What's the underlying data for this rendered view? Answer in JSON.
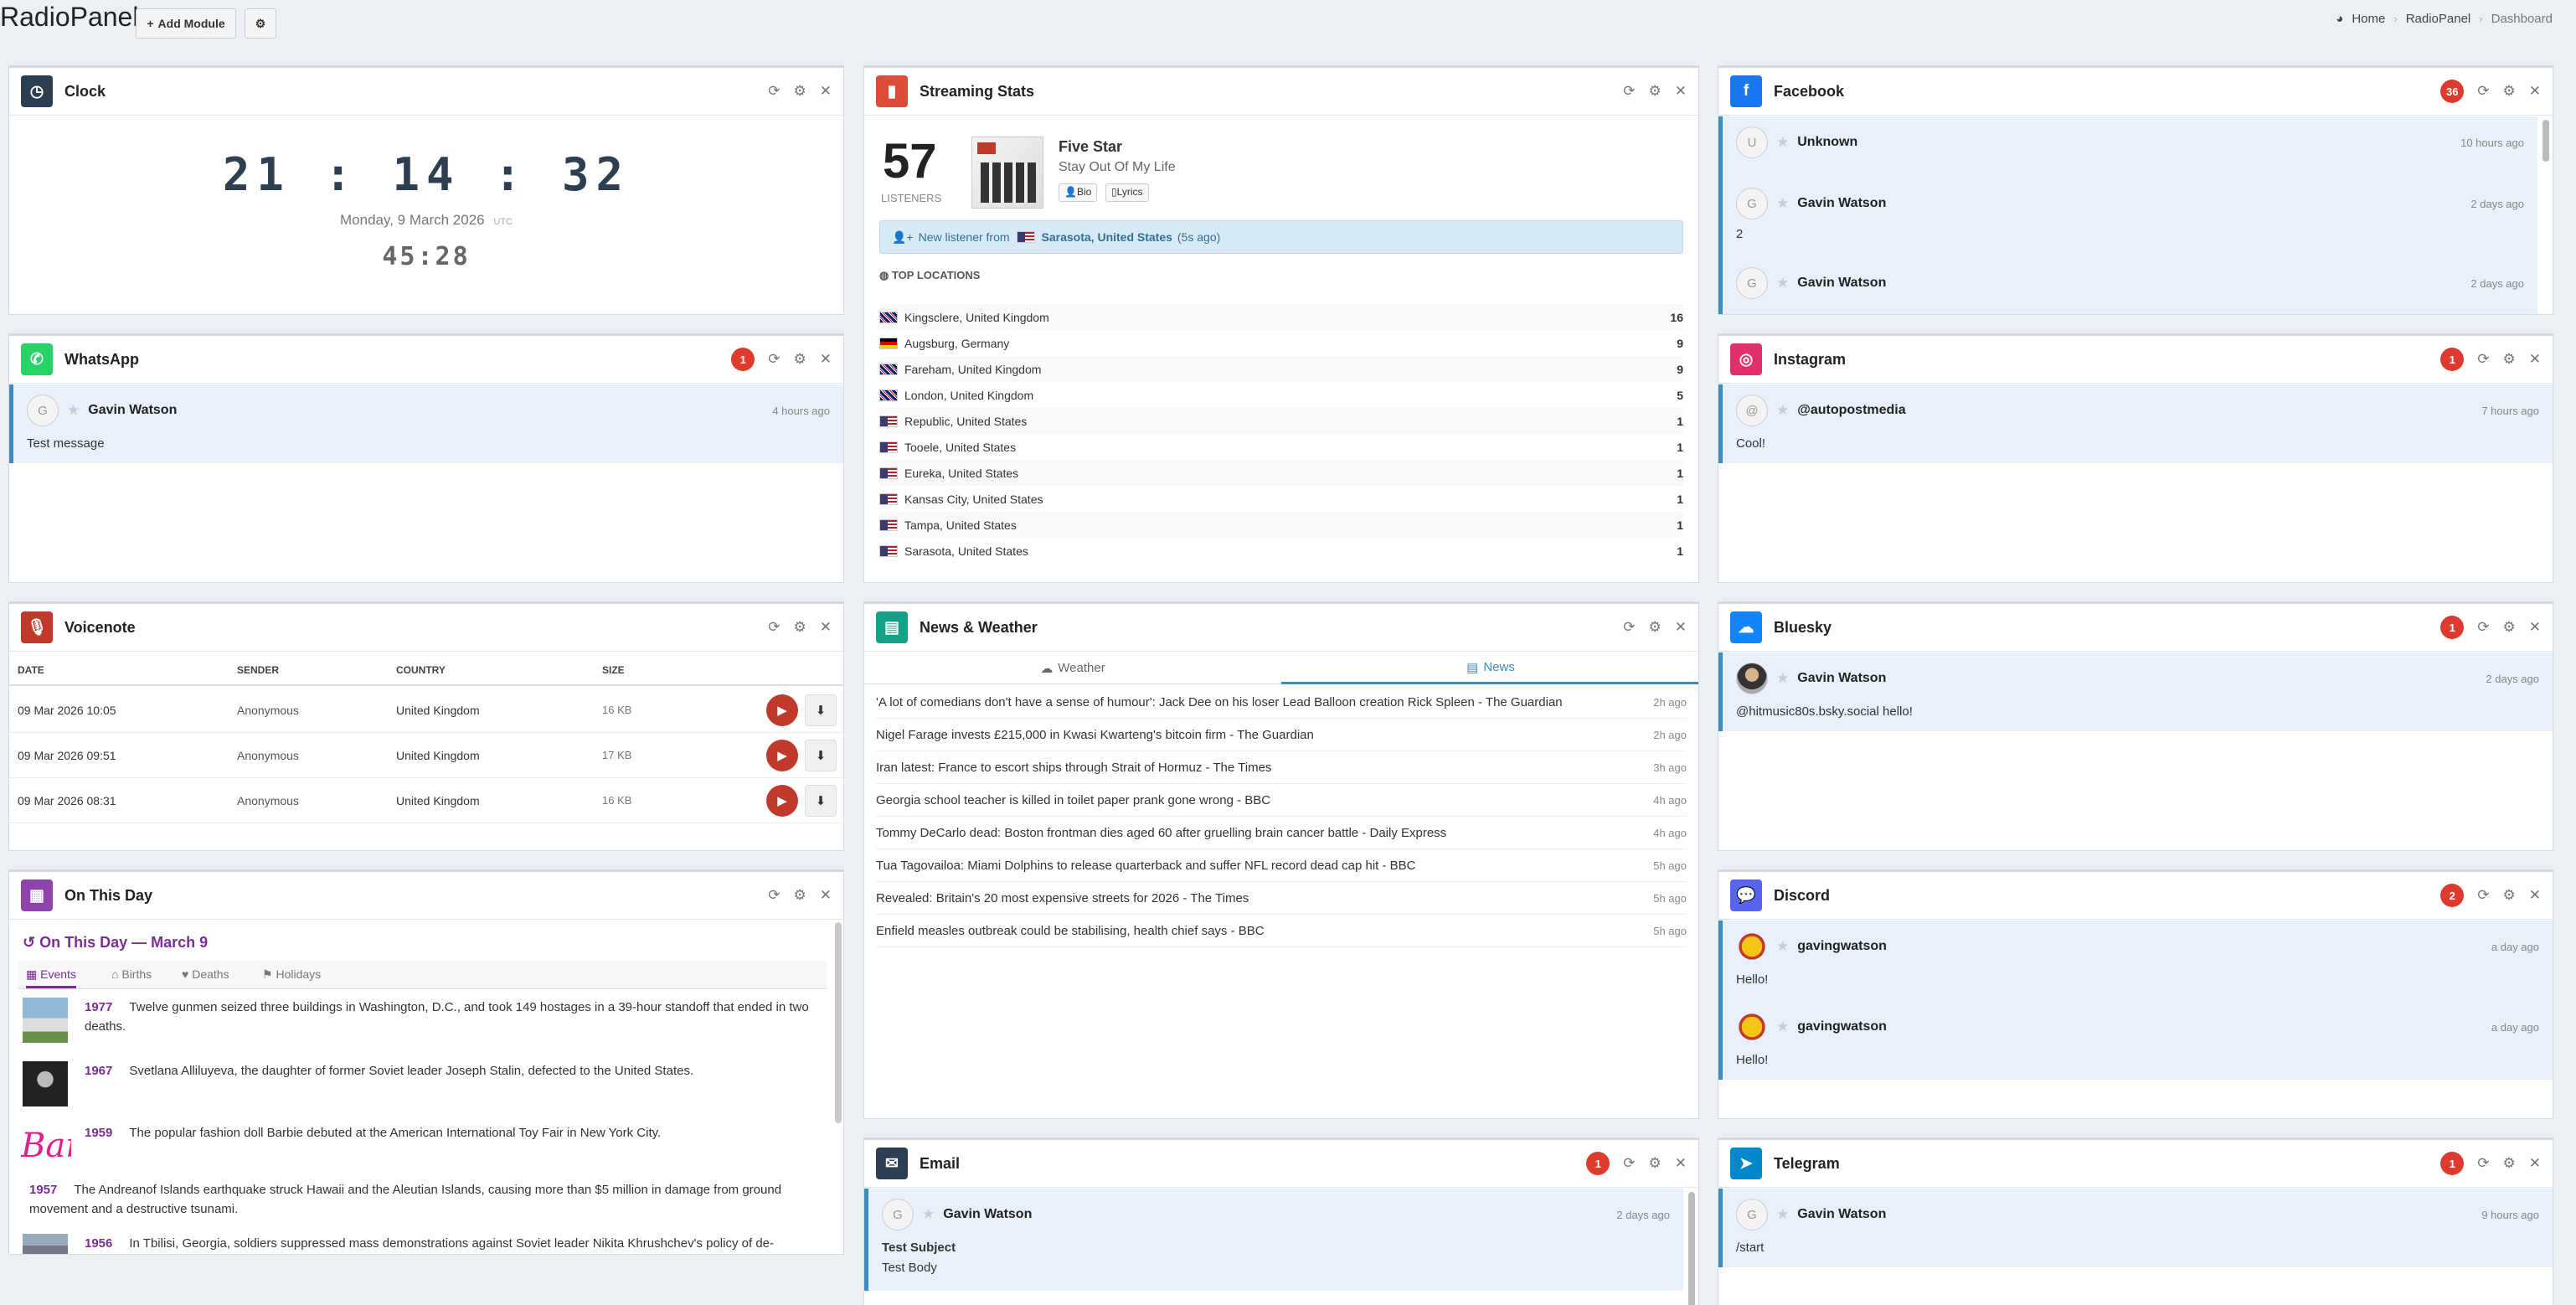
{
  "app": {
    "title": "RadioPanel",
    "add_module": "Add Module"
  },
  "breadcrumb": {
    "home": "Home",
    "app": "RadioPanel",
    "current": "Dashboard"
  },
  "clock": {
    "title": "Clock",
    "time": "21 : 14 : 32",
    "date": "Monday, 9 March 2026",
    "tz": "UTC",
    "countdown": "45:28"
  },
  "streaming": {
    "title": "Streaming Stats",
    "listeners": "57",
    "listeners_label": "LISTENERS",
    "artist": "Five Star",
    "song": "Stay Out Of My Life",
    "bio": "Bio",
    "lyrics": "Lyrics",
    "new_listener_prefix": "New listener from",
    "new_listener_place": "Sarasota, United States",
    "new_listener_ago": "(5s ago)",
    "top_locations_label": "TOP LOCATIONS",
    "locations": [
      {
        "flag": "uk",
        "name": "Kingsclere, United Kingdom",
        "count": "16"
      },
      {
        "flag": "de",
        "name": "Augsburg, Germany",
        "count": "9"
      },
      {
        "flag": "uk",
        "name": "Fareham, United Kingdom",
        "count": "9"
      },
      {
        "flag": "uk",
        "name": "London, United Kingdom",
        "count": "5"
      },
      {
        "flag": "us",
        "name": "Republic, United States",
        "count": "1"
      },
      {
        "flag": "us",
        "name": "Tooele, United States",
        "count": "1"
      },
      {
        "flag": "us",
        "name": "Eureka, United States",
        "count": "1"
      },
      {
        "flag": "us",
        "name": "Kansas City, United States",
        "count": "1"
      },
      {
        "flag": "us",
        "name": "Tampa, United States",
        "count": "1"
      },
      {
        "flag": "us",
        "name": "Sarasota, United States",
        "count": "1"
      }
    ]
  },
  "facebook": {
    "title": "Facebook",
    "badge": "36",
    "messages": [
      {
        "avatar": "U",
        "sender": "Unknown",
        "ago": "10 hours ago",
        "text": ""
      },
      {
        "avatar": "G",
        "sender": "Gavin Watson",
        "ago": "2 days ago",
        "text": "2"
      },
      {
        "avatar": "G",
        "sender": "Gavin Watson",
        "ago": "2 days ago",
        "text": ""
      }
    ]
  },
  "whatsapp": {
    "title": "WhatsApp",
    "badge": "1",
    "avatar": "G",
    "sender": "Gavin Watson",
    "ago": "4 hours ago",
    "text": "Test message"
  },
  "instagram": {
    "title": "Instagram",
    "badge": "1",
    "avatar": "@",
    "sender": "@autopostmedia",
    "ago": "7 hours ago",
    "text": "Cool!"
  },
  "voicenote": {
    "title": "Voicenote",
    "headers": [
      "DATE",
      "SENDER",
      "COUNTRY",
      "SIZE"
    ],
    "rows": [
      {
        "date": "09 Mar 2026 10:05",
        "sender": "Anonymous",
        "country": "United Kingdom",
        "size": "16 KB"
      },
      {
        "date": "09 Mar 2026 09:51",
        "sender": "Anonymous",
        "country": "United Kingdom",
        "size": "17 KB"
      },
      {
        "date": "09 Mar 2026 08:31",
        "sender": "Anonymous",
        "country": "United Kingdom",
        "size": "16 KB"
      }
    ]
  },
  "news": {
    "title": "News & Weather",
    "tab_weather": "Weather",
    "tab_news": "News",
    "items": [
      {
        "title": "'A lot of comedians don't have a sense of humour': Jack Dee on his loser Lead Balloon creation Rick Spleen - The Guardian",
        "ago": "2h ago"
      },
      {
        "title": "Nigel Farage invests £215,000 in Kwasi Kwarteng's bitcoin firm - The Guardian",
        "ago": "2h ago"
      },
      {
        "title": "Iran latest: France to escort ships through Strait of Hormuz - The Times",
        "ago": "3h ago"
      },
      {
        "title": "Georgia school teacher is killed in toilet paper prank gone wrong - BBC",
        "ago": "4h ago"
      },
      {
        "title": "Tommy DeCarlo dead: Boston frontman dies aged 60 after gruelling brain cancer battle - Daily Express",
        "ago": "4h ago"
      },
      {
        "title": "Tua Tagovailoa: Miami Dolphins to release quarterback and suffer NFL record dead cap hit - BBC",
        "ago": "5h ago"
      },
      {
        "title": "Revealed: Britain's 20 most expensive streets for 2026 - The Times",
        "ago": "5h ago"
      },
      {
        "title": "Enfield measles outbreak could be stabilising, health chief says - BBC",
        "ago": "5h ago"
      }
    ]
  },
  "bluesky": {
    "title": "Bluesky",
    "badge": "1",
    "sender": "Gavin Watson",
    "ago": "2 days ago",
    "text": "@hitmusic80s.bsky.social hello!"
  },
  "onthisday": {
    "title": "On This Day",
    "heading": "On This Day — March 9",
    "tabs": [
      "Events",
      "Births",
      "Deaths",
      "Holidays"
    ],
    "events": [
      {
        "year": "1977",
        "text": "Twelve gunmen seized three buildings in Washington, D.C., and took 149 hostages in a 39-hour standoff that ended in two deaths."
      },
      {
        "year": "1967",
        "text": "Svetlana Alliluyeva, the daughter of former Soviet leader Joseph Stalin, defected to the United States."
      },
      {
        "year": "1959",
        "text": "The popular fashion doll Barbie debuted at the American International Toy Fair in New York City."
      },
      {
        "year": "1957",
        "text": "The Andreanof Islands earthquake struck Hawaii and the Aleutian Islands, causing more than $5 million in damage from ground movement and a destructive tsunami."
      },
      {
        "year": "1956",
        "text": "In Tbilisi, Georgia, soldiers suppressed mass demonstrations against Soviet leader Nikita Khrushchev's policy of de-"
      }
    ],
    "barbie_logo": "Barbie"
  },
  "discord": {
    "title": "Discord",
    "badge": "2",
    "messages": [
      {
        "sender": "gavingwatson",
        "ago": "a day ago",
        "text": "Hello!"
      },
      {
        "sender": "gavingwatson",
        "ago": "a day ago",
        "text": "Hello!"
      }
    ]
  },
  "email": {
    "title": "Email",
    "badge": "1",
    "avatar": "G",
    "sender": "Gavin Watson",
    "ago": "2 days ago",
    "subject": "Test Subject",
    "body": "Test Body"
  },
  "telegram": {
    "title": "Telegram",
    "badge": "1",
    "avatar": "G",
    "sender": "Gavin Watson",
    "ago": "9 hours ago",
    "text": "/start"
  }
}
